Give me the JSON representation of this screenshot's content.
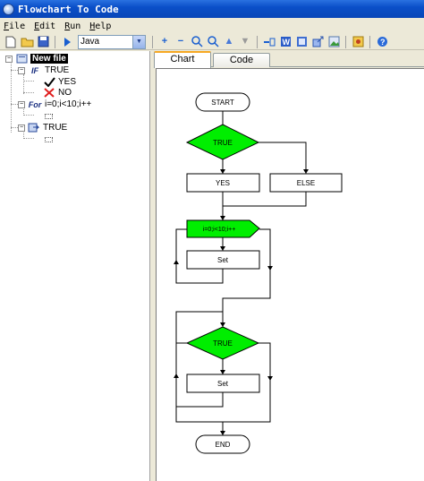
{
  "window": {
    "title": "Flowchart To Code"
  },
  "menu": [
    "File",
    "Edit",
    "Run",
    "Help"
  ],
  "toolbar": {
    "language": "Java"
  },
  "tree": {
    "root": "New file",
    "if_label": "TRUE",
    "if_tag": "IF",
    "yes_label": "YES",
    "no_label": "NO",
    "for_tag": "For",
    "for_label": "i=0;i<10;i++",
    "while_label": "TRUE"
  },
  "tabs": [
    {
      "label": "Chart",
      "active": true
    },
    {
      "label": "Code",
      "active": false
    }
  ],
  "flowchart": {
    "start": "START",
    "if_condition": "TRUE",
    "yes_box": "YES",
    "else_box": "ELSE",
    "for_header": "i=0;i<10;i++",
    "for_body": "Set",
    "while_condition": "TRUE",
    "while_body": "Set",
    "end": "END",
    "colors": {
      "decision_fill": "#00ee00",
      "stroke": "#000000"
    }
  },
  "colors": {
    "titlebar": "#0a4fc8",
    "tab_highlight": "#f6a823"
  }
}
